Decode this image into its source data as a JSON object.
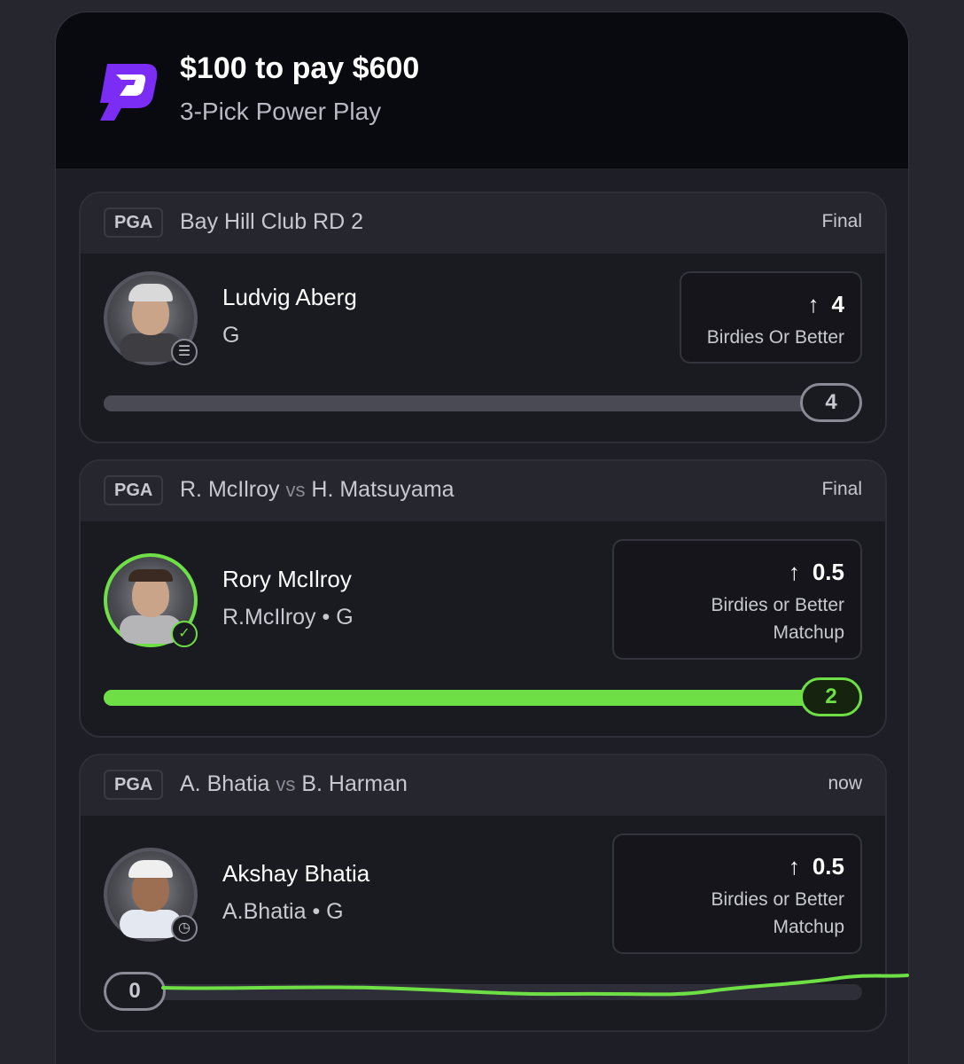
{
  "header": {
    "title": "$100 to pay $600",
    "subtitle": "3-Pick Power Play"
  },
  "colors": {
    "accent_green": "#6ee045",
    "brand_purple": "#7b2cf5"
  },
  "picks": [
    {
      "league": "PGA",
      "event_team_a": "Bay Hill Club RD 2",
      "event_vs": "",
      "event_team_b": "",
      "status": "Final",
      "player_name": "Ludvig Aberg",
      "player_sub": "G",
      "line_value": "4",
      "line_direction": "up-arrow-icon",
      "stat_line1": "Birdies Or Better",
      "stat_line2": "",
      "result": "4",
      "progress": 1.0,
      "hit": false
    },
    {
      "league": "PGA",
      "event_team_a": "R. McIlroy",
      "event_vs": "vs",
      "event_team_b": "H. Matsuyama",
      "status": "Final",
      "player_name": "Rory McIlroy",
      "player_sub": "R.McIlroy • G",
      "line_value": "0.5",
      "line_direction": "up-arrow-icon",
      "stat_line1": "Birdies or Better",
      "stat_line2": "Matchup",
      "result": "2",
      "progress": 1.0,
      "hit": true
    },
    {
      "league": "PGA",
      "event_team_a": "A. Bhatia",
      "event_vs": "vs",
      "event_team_b": "B. Harman",
      "status": "now",
      "player_name": "Akshay Bhatia",
      "player_sub": "A.Bhatia • G",
      "line_value": "0.5",
      "line_direction": "up-arrow-icon",
      "stat_line1": "Birdies or Better",
      "stat_line2": "Matchup",
      "result": "0",
      "progress": 0.0,
      "hit": false
    }
  ]
}
